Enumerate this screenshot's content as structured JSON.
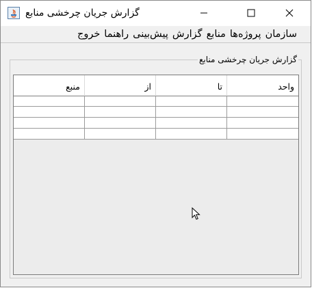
{
  "window": {
    "title": "گزارش جریان چرخشی منابع"
  },
  "menu": [
    {
      "label": "سازمان"
    },
    {
      "label": "پروژه‌ها"
    },
    {
      "label": "منابع"
    },
    {
      "label": "گزارش"
    },
    {
      "label": "پیش‌بینی"
    },
    {
      "label": "راهنما"
    },
    {
      "label": "خروج"
    }
  ],
  "report": {
    "caption": "گزارش جریان چرخشی منابع",
    "columns": [
      "واحد",
      "تا",
      "از",
      "منبع"
    ],
    "rows": [
      [
        "",
        "",
        "",
        ""
      ],
      [
        "",
        "",
        "",
        ""
      ],
      [
        "",
        "",
        "",
        ""
      ],
      [
        "",
        "",
        "",
        ""
      ]
    ]
  },
  "icons": {
    "app": "java-app-icon",
    "minimize": "minimize-icon",
    "maximize": "maximize-icon",
    "close": "close-icon",
    "cursor": "mouse-pointer-icon"
  }
}
